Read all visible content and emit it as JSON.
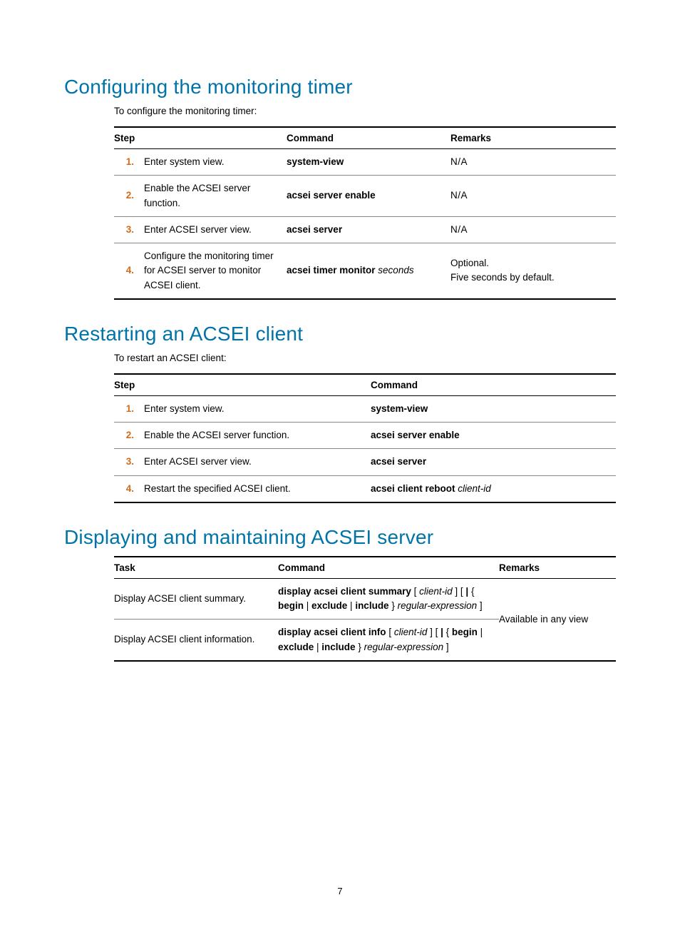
{
  "page_number": "7",
  "sections": {
    "s1": {
      "title": "Configuring the monitoring timer",
      "intro": "To configure the monitoring timer:",
      "headers": {
        "step": "Step",
        "cmd": "Command",
        "rem": "Remarks"
      },
      "rows": [
        {
          "n": "1.",
          "desc": "Enter system view.",
          "cmd_b": "system-view",
          "cmd_i": "",
          "rem1": "N/A",
          "rem2": ""
        },
        {
          "n": "2.",
          "desc": "Enable the ACSEI server function.",
          "cmd_b": "acsei server enable",
          "cmd_i": "",
          "rem1": "N/A",
          "rem2": ""
        },
        {
          "n": "3.",
          "desc": "Enter ACSEI server view.",
          "cmd_b": "acsei server",
          "cmd_i": "",
          "rem1": "N/A",
          "rem2": ""
        },
        {
          "n": "4.",
          "desc": "Configure the monitoring timer for ACSEI server to monitor ACSEI client.",
          "cmd_b": "acsei timer monitor ",
          "cmd_i": "seconds",
          "rem1": "Optional.",
          "rem2": "Five seconds by default."
        }
      ]
    },
    "s2": {
      "title": "Restarting an ACSEI client",
      "intro": "To restart an ACSEI client:",
      "headers": {
        "step": "Step",
        "cmd": "Command"
      },
      "rows": [
        {
          "n": "1.",
          "desc": "Enter system view.",
          "cmd_b": "system-view",
          "cmd_i": ""
        },
        {
          "n": "2.",
          "desc": "Enable the ACSEI server function.",
          "cmd_b": "acsei server enable",
          "cmd_i": ""
        },
        {
          "n": "3.",
          "desc": "Enter ACSEI server view.",
          "cmd_b": "acsei server",
          "cmd_i": ""
        },
        {
          "n": "4.",
          "desc": "Restart the specified ACSEI client.",
          "cmd_b": "acsei client reboot ",
          "cmd_i": "client-id"
        }
      ]
    },
    "s3": {
      "title": "Displaying and maintaining ACSEI server",
      "headers": {
        "task": "Task",
        "cmd": "Command",
        "rem": "Remarks"
      },
      "remarks_shared": "Available in any view",
      "rows": [
        {
          "task": "Display ACSEI client summary.",
          "cmd_parts": [
            {
              "t": "display acsei client summary",
              "b": true
            },
            {
              "t": " [ "
            },
            {
              "t": "client-id",
              "i": true
            },
            {
              "t": " ] [ "
            },
            {
              "t": "|",
              "b": true
            },
            {
              "t": " { "
            },
            {
              "t": "begin",
              "b": true
            },
            {
              "t": " | "
            },
            {
              "t": "exclude",
              "b": true
            },
            {
              "t": " | "
            },
            {
              "t": "include",
              "b": true
            },
            {
              "t": " } "
            },
            {
              "t": "regular-expression",
              "i": true
            },
            {
              "t": " ]"
            }
          ]
        },
        {
          "task": "Display ACSEI client information.",
          "cmd_parts": [
            {
              "t": "display acsei client info",
              "b": true
            },
            {
              "t": " [ "
            },
            {
              "t": "client-id",
              "i": true
            },
            {
              "t": " ] [ "
            },
            {
              "t": "|",
              "b": true
            },
            {
              "t": " { "
            },
            {
              "t": "begin",
              "b": true
            },
            {
              "t": " | "
            },
            {
              "t": "exclude",
              "b": true
            },
            {
              "t": " | "
            },
            {
              "t": "include",
              "b": true
            },
            {
              "t": " } "
            },
            {
              "t": "regular-expression",
              "i": true
            },
            {
              "t": " ]"
            }
          ]
        }
      ]
    }
  }
}
